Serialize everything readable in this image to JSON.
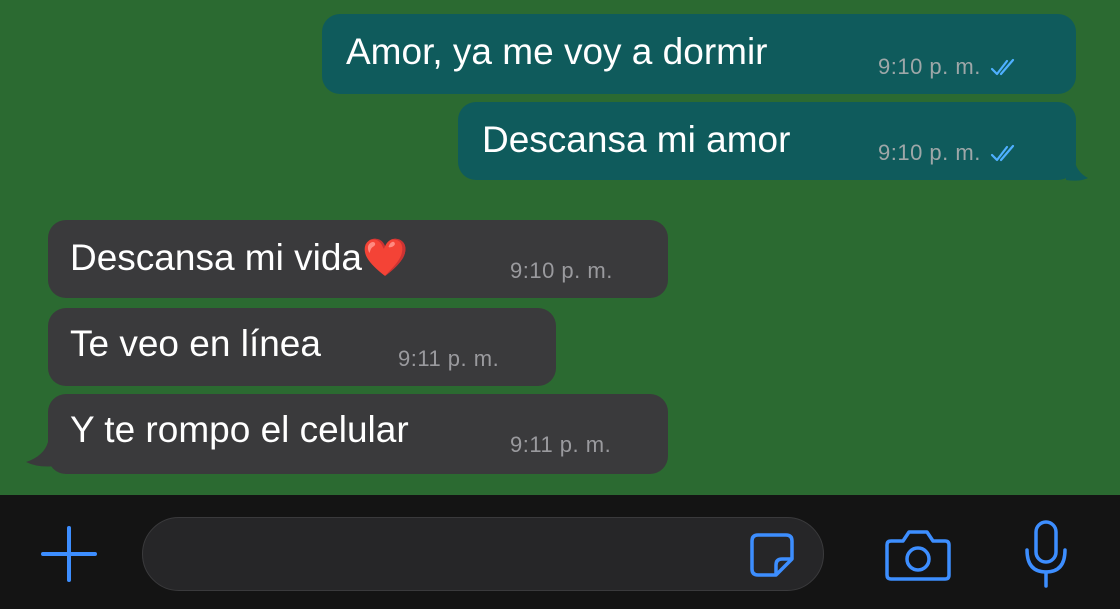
{
  "messages": [
    {
      "direction": "outgoing",
      "text": "Amor, ya me voy a dormir",
      "time": "9:10 p. m.",
      "status": "read"
    },
    {
      "direction": "outgoing",
      "text": "Descansa mi amor",
      "time": "9:10 p. m.",
      "status": "read"
    },
    {
      "direction": "incoming",
      "text": "Descansa mi vida❤️",
      "time": "9:10 p. m."
    },
    {
      "direction": "incoming",
      "text": "Te veo en línea",
      "time": "9:11 p. m."
    },
    {
      "direction": "incoming",
      "text": "Y te rompo el celular",
      "time": "9:11 p. m."
    }
  ],
  "input_bar": {
    "message_value": "",
    "icons": [
      "plus-icon",
      "sticker-icon",
      "camera-icon",
      "microphone-icon"
    ]
  },
  "colors": {
    "chat_background": "#2b6a31",
    "outgoing_bubble": "#0f5b5c",
    "incoming_bubble": "#3a3a3c",
    "read_ticks": "#4fb0ff",
    "accent_icons": "#3d8eff",
    "input_bar_background": "#141414"
  }
}
